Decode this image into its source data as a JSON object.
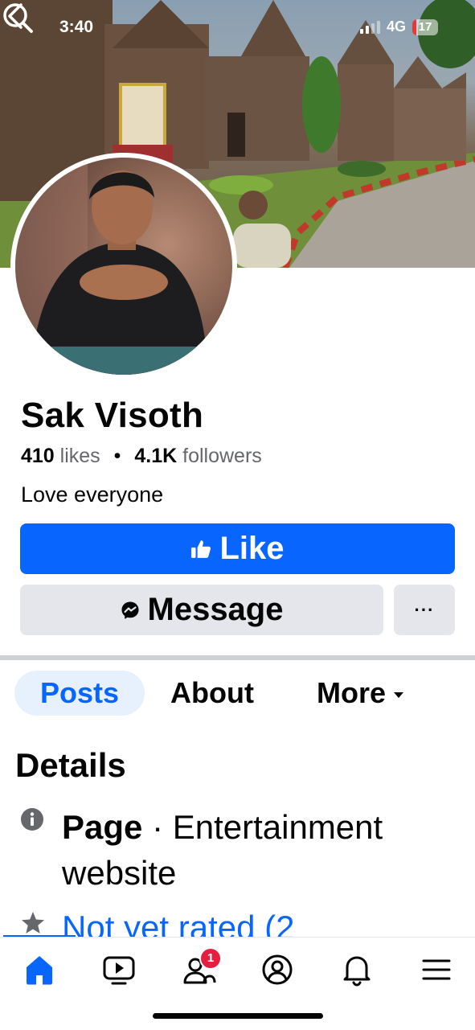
{
  "status_bar": {
    "time": "3:40",
    "network": "4G",
    "battery": "17"
  },
  "profile": {
    "name": "Sak Visoth",
    "likes_count": "410",
    "likes_label": "likes",
    "followers_count": "4.1K",
    "followers_label": "followers",
    "bio": "Love everyone"
  },
  "actions": {
    "like_label": "Like",
    "message_label": "Message",
    "more_label": "···"
  },
  "tabs": [
    {
      "label": "Posts",
      "active": true
    },
    {
      "label": "About"
    },
    {
      "label": "More"
    }
  ],
  "details": {
    "title": "Details",
    "page_type": "Page",
    "page_category": "· Entertainment website",
    "rating": "Not yet rated (2"
  },
  "bottom_nav": {
    "notification_badge": "1"
  },
  "colors": {
    "accent": "#0866ff",
    "badge": "#e41e3f",
    "button_gray": "#e4e6eb"
  },
  "icons": [
    "back-icon",
    "search-icon",
    "thumbs-up-icon",
    "messenger-icon",
    "info-icon",
    "star-icon",
    "home-icon",
    "video-icon",
    "friends-icon",
    "profile-icon",
    "bell-icon",
    "menu-icon"
  ]
}
